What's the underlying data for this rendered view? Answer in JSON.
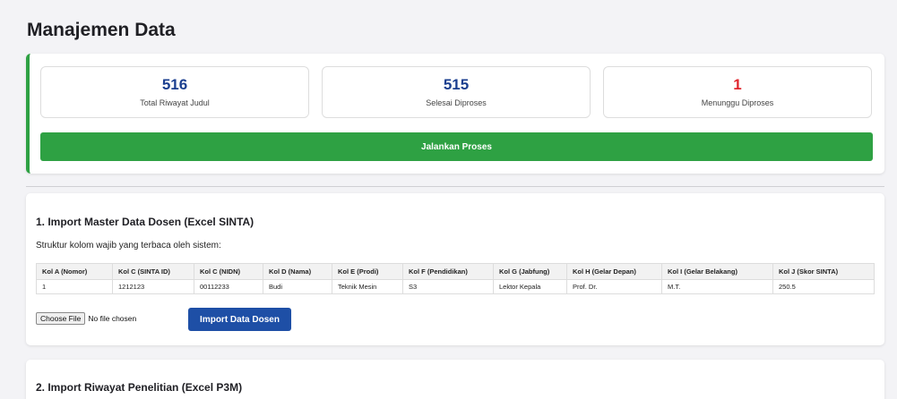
{
  "page": {
    "title": "Manajemen Data"
  },
  "stats": [
    {
      "value": "516",
      "label": "Total Riwayat Judul"
    },
    {
      "value": "515",
      "label": "Selesai Diproses"
    },
    {
      "value": "1",
      "label": "Menunggu Diproses"
    }
  ],
  "run_button": {
    "label": "Jalankan Proses"
  },
  "colors": {
    "green": "#2ea143",
    "blue": "#1e4fa6",
    "red": "#e0262d",
    "stat_blue": "#1b3f8f"
  },
  "section1": {
    "title": "1. Import Master Data Dosen (Excel SINTA)",
    "description": "Struktur kolom wajib yang terbaca oleh sistem:",
    "table": {
      "headers": [
        "Kol A (Nomor)",
        "Kol C (SINTA ID)",
        "Kol C (NIDN)",
        "Kol D (Nama)",
        "Kol E (Prodi)",
        "Kol F (Pendidikan)",
        "Kol G (Jabfung)",
        "Kol H (Gelar Depan)",
        "Kol I (Gelar Belakang)",
        "Kol J (Skor SINTA)"
      ],
      "row": [
        "1",
        "1212123",
        "00112233",
        "Budi",
        "Teknik Mesin",
        "S3",
        "Lektor Kepala",
        "Prof. Dr.",
        "M.T.",
        "250.5"
      ]
    },
    "file_input": {
      "button_label": "Choose File",
      "status": "No file chosen"
    },
    "import_button": {
      "label": "Import Data Dosen"
    }
  },
  "section2": {
    "title": "2. Import Riwayat Penelitian (Excel P3M)"
  }
}
